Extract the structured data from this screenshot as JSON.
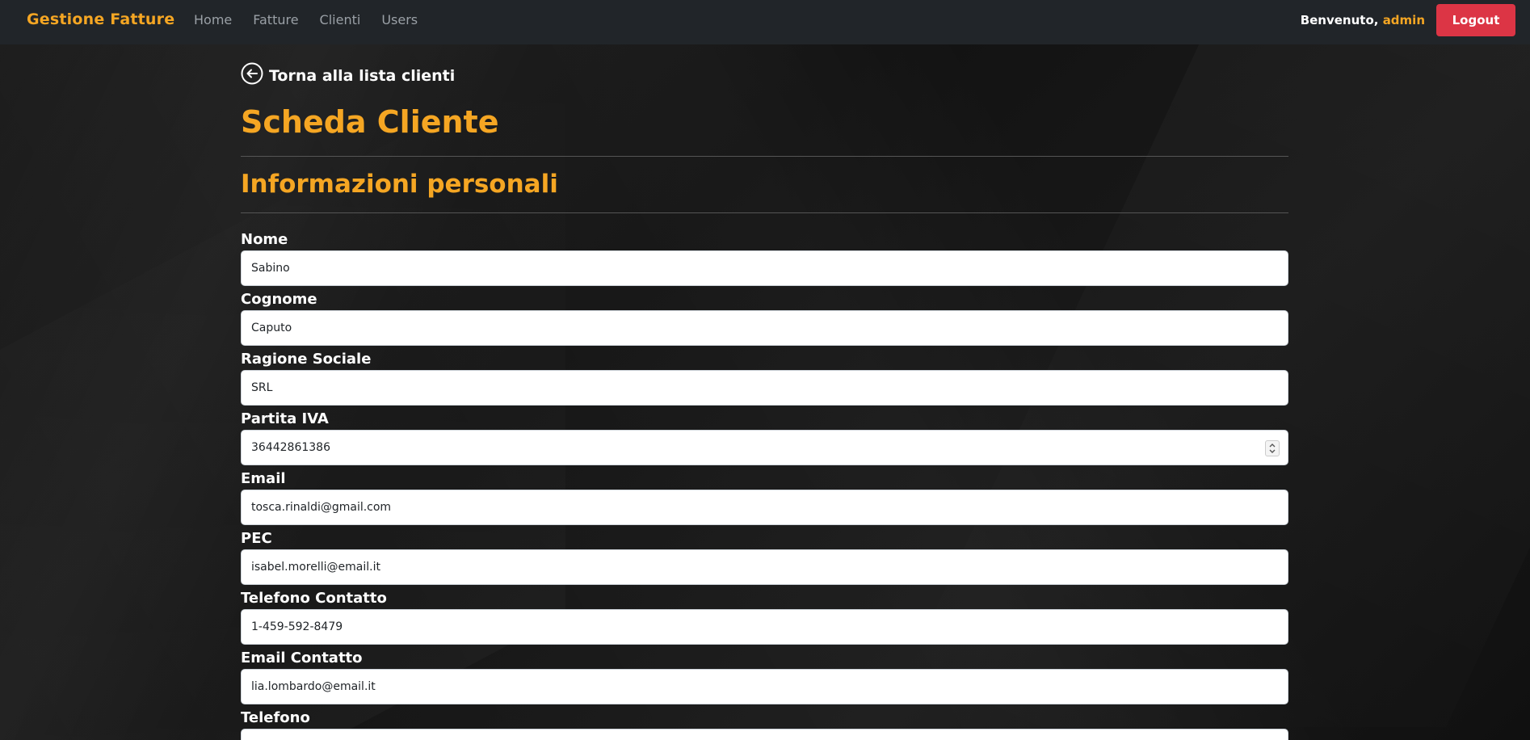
{
  "navbar": {
    "brand": "Gestione Fatture",
    "links": [
      "Home",
      "Fatture",
      "Clienti",
      "Users"
    ],
    "welcome_prefix": "Benvenuto, ",
    "username": "admin",
    "logout_label": "Logout"
  },
  "page": {
    "back_label": "Torna alla lista clienti",
    "title": "Scheda Cliente",
    "section_title": "Informazioni personali"
  },
  "fields": [
    {
      "label": "Nome",
      "value": "Sabino"
    },
    {
      "label": "Cognome",
      "value": "Caputo"
    },
    {
      "label": "Ragione Sociale",
      "value": "SRL"
    },
    {
      "label": "Partita IVA",
      "value": "36442861386"
    },
    {
      "label": "Email",
      "value": "tosca.rinaldi@gmail.com"
    },
    {
      "label": "PEC",
      "value": "isabel.morelli@email.it"
    },
    {
      "label": "Telefono Contatto",
      "value": "1-459-592-8479"
    },
    {
      "label": "Email Contatto",
      "value": "lia.lombardo@email.it"
    },
    {
      "label": "Telefono",
      "value": ""
    }
  ],
  "colors": {
    "accent": "#f5a623",
    "navbar_bg": "#212529",
    "logout_bg": "#dc3545"
  },
  "icons": {
    "back": "arrow-left-circle-icon",
    "spinner": "number-spinner-icon"
  }
}
